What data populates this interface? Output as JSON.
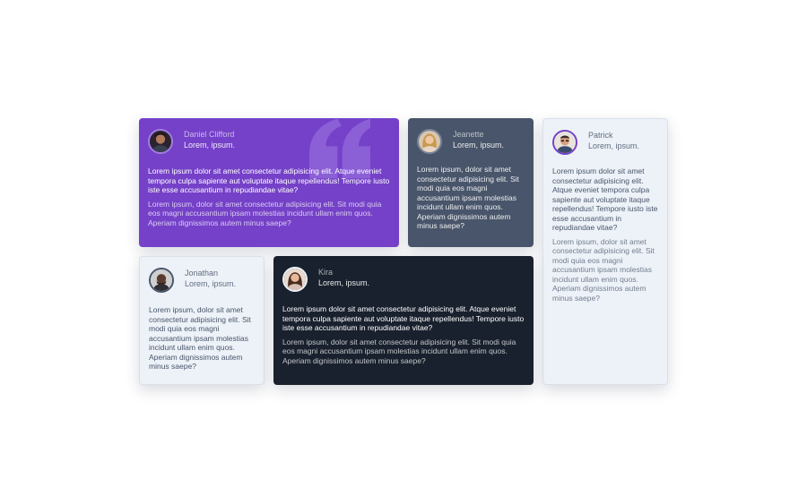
{
  "testimonials": [
    {
      "name": "Daniel Clifford",
      "role": "Lorem, ipsum.",
      "headline": "Lorem ipsum dolor sit amet consectetur adipisicing elit. Atque eveniet tempora culpa sapiente aut voluptate itaque repellendus! Tempore iusto iste esse accusantium in repudiandae vitae?",
      "text": "Lorem ipsum, dolor sit amet consectetur adipisicing elit. Sit modi quia eos magni accusantium ipsam molestias incidunt ullam enim quos. Aperiam dignissimos autem minus saepe?"
    },
    {
      "name": "Jeanette",
      "role": "Lorem, ipsum.",
      "headline": "Lorem ipsum, dolor sit amet consectetur adipisicing elit. Sit modi quia eos magni accusantium ipsam molestias incidunt ullam enim quos. Aperiam dignissimos autem minus saepe?",
      "text": ""
    },
    {
      "name": "Patrick",
      "role": "Lorem, ipsum.",
      "headline": "Lorem ipsum dolor sit amet consectetur adipisicing elit. Atque eveniet tempora culpa sapiente aut voluptate itaque repellendus! Tempore iusto iste esse accusantium in repudiandae vitae?",
      "text": "Lorem ipsum, dolor sit amet consectetur adipisicing elit. Sit modi quia eos magni accusantium ipsam molestias incidunt ullam enim quos. Aperiam dignissimos autem minus saepe?"
    },
    {
      "name": "Jonathan",
      "role": "Lorem, ipsum.",
      "headline": "Lorem ipsum, dolor sit amet consectetur adipisicing elit. Sit modi quia eos magni accusantium ipsam molestias incidunt ullam enim quos. Aperiam dignissimos autem minus saepe?",
      "text": ""
    },
    {
      "name": "Kira",
      "role": "Lorem, ipsum.",
      "headline": "Lorem ipsum dolor sit amet consectetur adipisicing elit. Atque eveniet tempora culpa sapiente aut voluptate itaque repellendus! Tempore iusto iste esse accusantium in repudiandae vitae?",
      "text": "Lorem ipsum, dolor sit amet consectetur adipisicing elit. Sit modi quia eos magni accusantium ipsam molestias incidunt ullam enim quos. Aperiam dignissimos autem minus saepe?"
    }
  ],
  "colors": {
    "violet": "#7541c8",
    "slate": "#48556a",
    "light": "#edf2f8",
    "dark": "#19212e"
  },
  "icons": {
    "quote": "quote-icon",
    "avatar": "avatar-photo"
  }
}
